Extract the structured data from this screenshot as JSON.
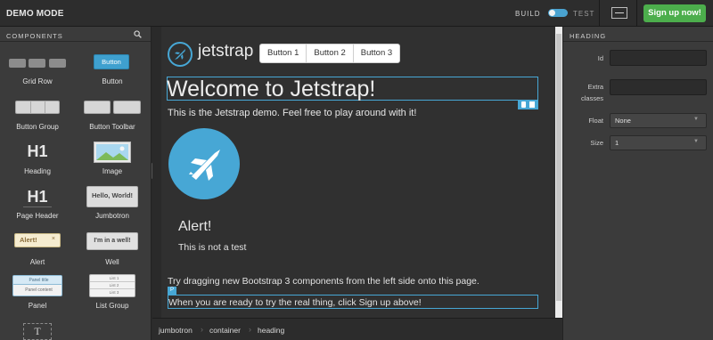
{
  "topbar": {
    "mode_label": "DEMO MODE",
    "build_label": "BUILD",
    "test_label": "TEST",
    "signup_label": "Sign up now!"
  },
  "components_panel": {
    "title": "COMPONENTS",
    "items": [
      {
        "label": "Grid Row",
        "icon": "grid-row-icon"
      },
      {
        "label": "Button",
        "icon": "button-icon",
        "preview_text": "Button"
      },
      {
        "label": "Button Group",
        "icon": "button-group-icon"
      },
      {
        "label": "Button Toolbar",
        "icon": "button-toolbar-icon"
      },
      {
        "label": "Heading",
        "icon": "heading-icon",
        "preview_text": "H1"
      },
      {
        "label": "Image",
        "icon": "image-icon"
      },
      {
        "label": "Page Header",
        "icon": "page-header-icon",
        "preview_text": "H1"
      },
      {
        "label": "Jumbotron",
        "icon": "jumbotron-icon",
        "preview_text": "Hello, World!"
      },
      {
        "label": "Alert",
        "icon": "alert-icon",
        "preview_text": "Alert!"
      },
      {
        "label": "Well",
        "icon": "well-icon",
        "preview_text": "I'm in a well!"
      },
      {
        "label": "Panel",
        "icon": "panel-icon",
        "preview_text": [
          "Panel title",
          "Panel content"
        ]
      },
      {
        "label": "List Group",
        "icon": "list-group-icon",
        "preview_text": [
          "List 1",
          "List 2",
          "List 3"
        ]
      },
      {
        "label": "",
        "icon": "text-icon",
        "preview_text": "T"
      }
    ]
  },
  "canvas": {
    "brand": "jetstrap",
    "buttons": [
      "Button 1",
      "Button 2",
      "Button 3"
    ],
    "heading": "Welcome to Jetstrap!",
    "intro": "This is the Jetstrap demo. Feel free to play around with it!",
    "alert_heading": "Alert!",
    "alert_text": "This is not a test",
    "try_text": "Try dragging new Bootstrap 3 components from the left side onto this page.",
    "paragraph_tag": "P",
    "ready_text": "When you are ready to try the real thing, click Sign up above!",
    "accent_color": "#47a7d5"
  },
  "breadcrumb": [
    "jumbotron",
    "container",
    "heading"
  ],
  "properties_panel": {
    "title": "HEADING",
    "id_label": "Id",
    "extra_label_1": "Extra",
    "extra_label_2": "classes",
    "float_label": "Float",
    "float_value": "None",
    "size_label": "Size",
    "size_value": "1"
  },
  "colors": {
    "signup_green": "#4cae4c",
    "accent_blue": "#47a7d5",
    "panel_bg": "#3b3b3b"
  }
}
